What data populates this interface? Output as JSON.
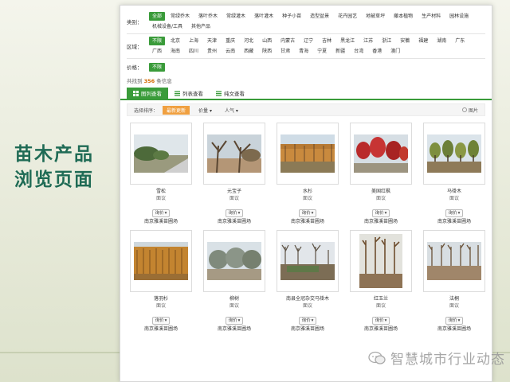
{
  "slide": {
    "title_line1": "苗木产品",
    "title_line2": "浏览页面",
    "watermark_text": "智慧城市行业动态"
  },
  "filters": {
    "category": {
      "label": "类别：",
      "options": [
        "全部",
        "常绿乔木",
        "落叶乔木",
        "常绿灌木",
        "落叶灌木",
        "种子小苗",
        "造型盆景",
        "花卉园艺",
        "地被草坪",
        "藤本植物",
        "生产材料",
        "园林设施",
        "机械设备/工具",
        "其他产品"
      ],
      "active_index": 0
    },
    "region": {
      "label": "区域：",
      "options": [
        "不限",
        "北京",
        "上海",
        "天津",
        "重庆",
        "河北",
        "山西",
        "内蒙古",
        "辽宁",
        "吉林",
        "黑龙江",
        "江苏",
        "浙江",
        "安徽",
        "福建",
        "湖南",
        "广东",
        "广西",
        "海南",
        "四川",
        "贵州",
        "云南",
        "西藏",
        "陕西",
        "甘肃",
        "青海",
        "宁夏",
        "新疆",
        "台湾",
        "香港",
        "澳门"
      ],
      "active_index": 0
    },
    "price": {
      "label": "价格：",
      "options": [
        "不限"
      ],
      "active_index": 0
    }
  },
  "results": {
    "prefix": "共找到",
    "count": "356",
    "suffix": "条信息"
  },
  "tabs": [
    {
      "label": "图列查看",
      "active": true
    },
    {
      "label": "列表查看",
      "active": false
    },
    {
      "label": "纯文查看",
      "active": false
    }
  ],
  "sort": {
    "label": "选择排序：",
    "buttons": [
      "最新更新",
      "价量 ▾",
      "人气 ▾"
    ],
    "active_index": 0,
    "right_label": "图片"
  },
  "products": [
    {
      "name": "雪松",
      "price": "面议",
      "btn": "询价",
      "seller": "南京雅溪苗圃场",
      "scene": "road"
    },
    {
      "name": "元宝子",
      "price": "面议",
      "btn": "询价",
      "seller": "南京雅溪苗圃场",
      "scene": "bare"
    },
    {
      "name": "水杉",
      "price": "面议",
      "btn": "询价",
      "seller": "南京雅溪苗圃场",
      "scene": "autumn"
    },
    {
      "name": "美国红枫",
      "price": "面议",
      "btn": "询价",
      "seller": "南京雅溪苗圃场",
      "scene": "redmaple"
    },
    {
      "name": "马褂木",
      "price": "面议",
      "btn": "询价",
      "seller": "南京雅溪苗圃场",
      "scene": "rows"
    },
    {
      "name": "落羽杉",
      "price": "面议",
      "btn": "询价",
      "seller": "南京雅溪苗圃场",
      "scene": "golden"
    },
    {
      "name": "柳树",
      "price": "面议",
      "btn": "询价",
      "seller": "南京雅溪苗圃场",
      "scene": "willow"
    },
    {
      "name": "南县全冠杂交马褂木",
      "price": "面议",
      "btn": "询价",
      "seller": "南京雅溪苗圃场",
      "scene": "winter"
    },
    {
      "name": "红玉兰",
      "price": "面议",
      "btn": "询价",
      "seller": "南京雅溪苗圃场",
      "scene": "tall"
    },
    {
      "name": "法桐",
      "price": "面议",
      "btn": "询价",
      "seller": "南京雅溪苗圃场",
      "scene": "plane"
    }
  ],
  "colors": {
    "accent": "#3a9b3a",
    "sort_active": "#f0a040",
    "title": "#1f6b55"
  }
}
